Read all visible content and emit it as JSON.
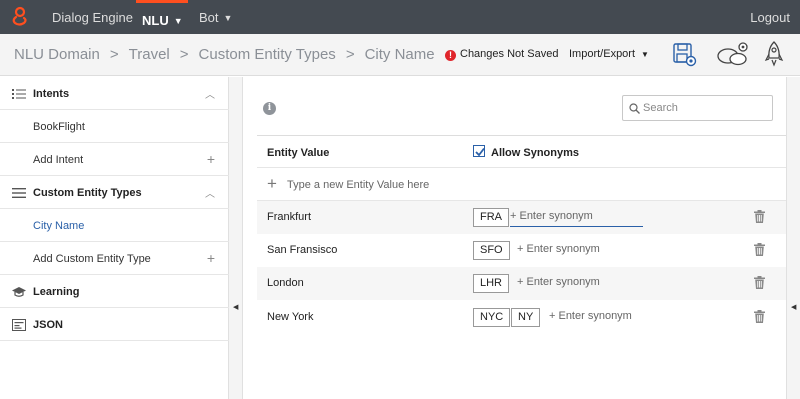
{
  "topnav": {
    "app_title": "Dialog Engine",
    "nlu_label": "NLU",
    "bot_label": "Bot",
    "logout_label": "Logout",
    "accent_color": "#ff4f1f"
  },
  "breadcrumb": {
    "items": [
      "NLU Domain",
      "Travel",
      "Custom Entity Types",
      "City Name"
    ],
    "separator": ">"
  },
  "toolbar": {
    "status_text": "Changes Not Saved",
    "status_icon": "!",
    "import_export_label": "Import/Export",
    "icons": [
      "save-settings-icon",
      "chat-settings-icon",
      "rocket-icon"
    ]
  },
  "sidebar": {
    "items": [
      {
        "label": "Intents",
        "type": "section",
        "icon": "list-icon",
        "control": "caret-up"
      },
      {
        "label": "BookFlight",
        "type": "sub"
      },
      {
        "label": "Add Intent",
        "type": "sub",
        "control": "plus"
      },
      {
        "label": "Custom Entity Types",
        "type": "section",
        "icon": "menu-icon",
        "control": "caret-up"
      },
      {
        "label": "City Name",
        "type": "sub",
        "active": true
      },
      {
        "label": "Add Custom Entity Type",
        "type": "sub",
        "control": "plus"
      },
      {
        "label": "Learning",
        "type": "section",
        "icon": "graduation-cap-icon"
      },
      {
        "label": "JSON",
        "type": "section",
        "icon": "json-icon"
      }
    ]
  },
  "main": {
    "info_icon": "i",
    "search_placeholder": "Search",
    "table": {
      "col_entity_value": "Entity Value",
      "col_allow_synonyms": "Allow Synonyms",
      "allow_synonyms_checked": true,
      "new_value_placeholder": "Type a new Entity Value here",
      "synonym_placeholder": "+ Enter synonym",
      "rows": [
        {
          "name": "Frankfurt",
          "synonyms": [
            "FRA"
          ],
          "focused": true
        },
        {
          "name": "San Fransisco",
          "synonyms": [
            "SFO"
          ]
        },
        {
          "name": "London",
          "synonyms": [
            "LHR"
          ]
        },
        {
          "name": "New York",
          "synonyms": [
            "NYC",
            "NY"
          ]
        }
      ]
    }
  }
}
